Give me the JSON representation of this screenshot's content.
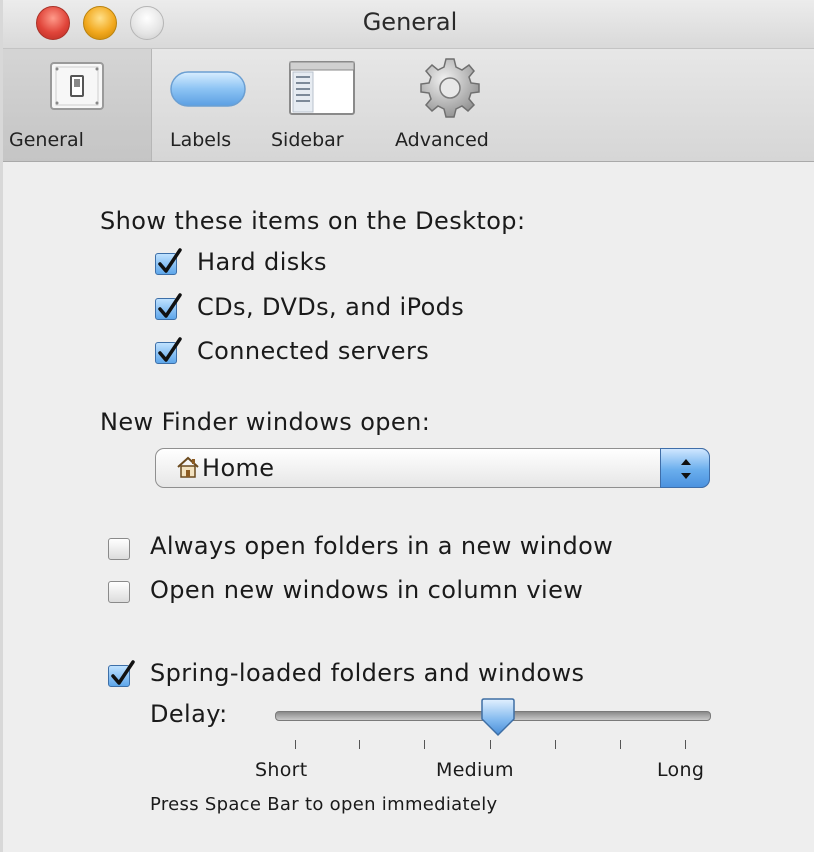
{
  "window": {
    "title": "General"
  },
  "toolbar": {
    "items": [
      {
        "label": "General",
        "icon": "switch-icon",
        "selected": true
      },
      {
        "label": "Labels",
        "icon": "label-pill-icon"
      },
      {
        "label": "Sidebar",
        "icon": "sidebar-window-icon"
      },
      {
        "label": "Advanced",
        "icon": "gear-icon"
      }
    ]
  },
  "desktop": {
    "heading": "Show these items on the Desktop:",
    "items": [
      {
        "label": "Hard disks",
        "checked": true
      },
      {
        "label": "CDs, DVDs, and iPods",
        "checked": true
      },
      {
        "label": "Connected servers",
        "checked": true
      }
    ]
  },
  "new_window": {
    "heading": "New Finder windows open:",
    "selected": "Home",
    "icon": "home-icon"
  },
  "options": [
    {
      "label": "Always open folders in a new window",
      "checked": false
    },
    {
      "label": "Open new windows in column view",
      "checked": false
    }
  ],
  "spring": {
    "label": "Spring-loaded folders and windows",
    "checked": true,
    "delay_label": "Delay:",
    "delay_value": 0.5,
    "short_label": "Short",
    "medium_label": "Medium",
    "long_label": "Long",
    "hint": "Press Space Bar to open immediately"
  },
  "colors": {
    "accent": "#5ea6ea",
    "background": "#eeeeee"
  }
}
